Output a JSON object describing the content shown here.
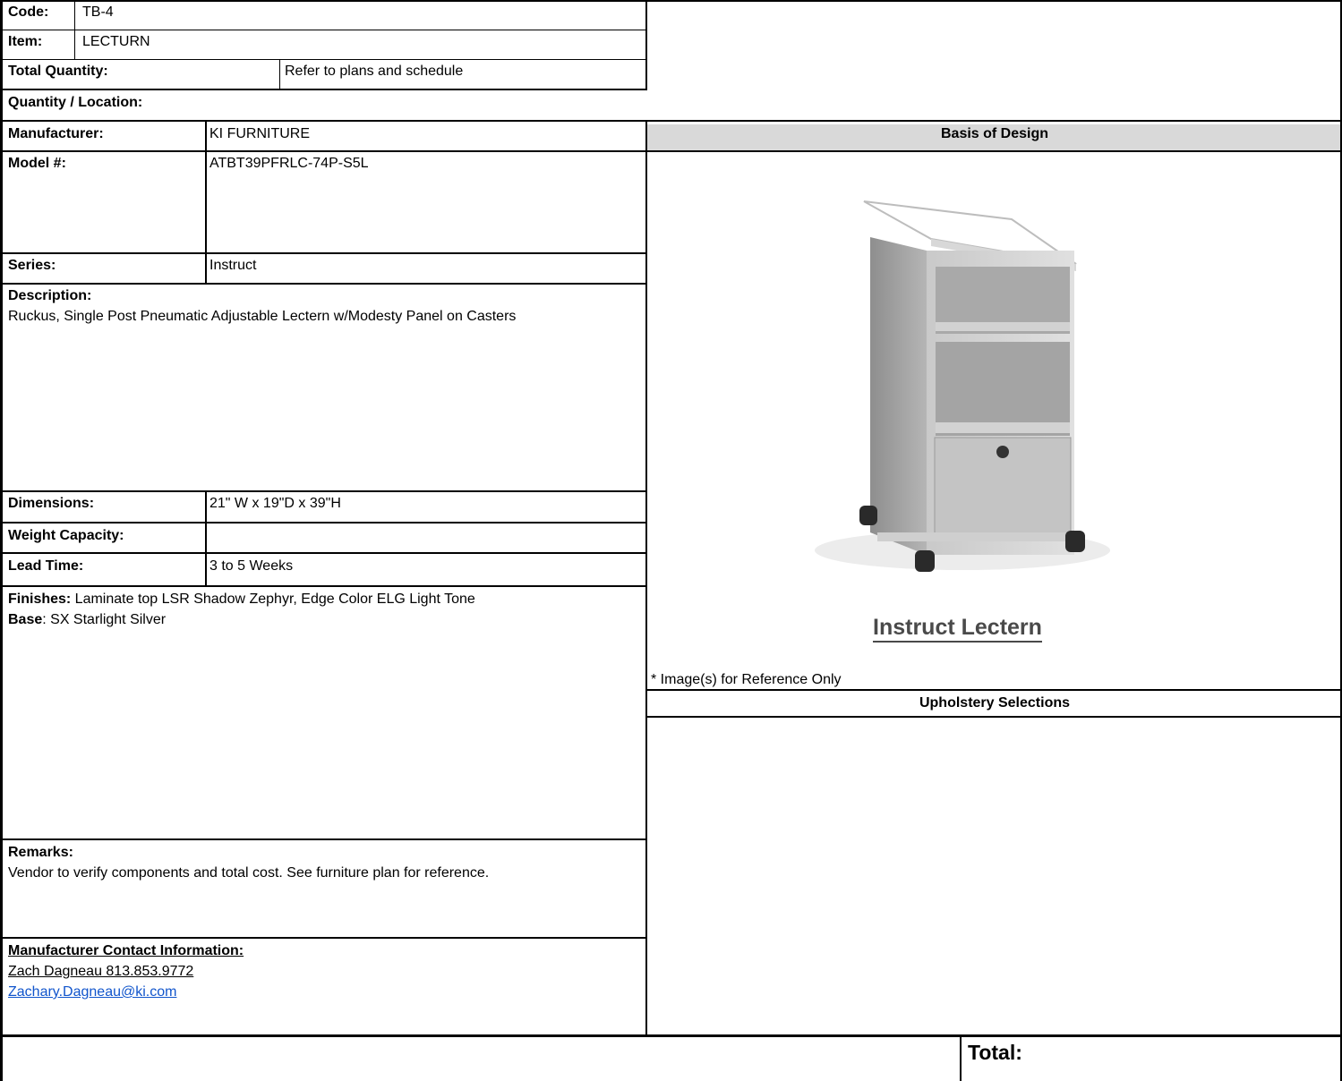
{
  "header": {
    "code_label": "Code:",
    "code_value": "TB-4",
    "item_label": "Item:",
    "item_value": "LECTURN",
    "total_qty_label": "Total Quantity:",
    "total_qty_value": "Refer to plans and schedule",
    "qty_location_label": "Quantity / Location:"
  },
  "specs": {
    "manufacturer_label": "Manufacturer:",
    "manufacturer_value": "KI FURNITURE",
    "model_label": "Model #:",
    "model_value": "ATBT39PFRLC-74P-S5L",
    "series_label": "Series:",
    "series_value": "Instruct",
    "description_label": "Description:",
    "description_value": "Ruckus, Single Post Pneumatic Adjustable Lectern w/Modesty Panel on Casters",
    "dimensions_label": "Dimensions:",
    "dimensions_value": "21\" W x 19\"D x 39\"H",
    "weight_label": "Weight Capacity:",
    "weight_value": "",
    "lead_time_label": "Lead Time:",
    "lead_time_value": "3 to 5 Weeks",
    "finishes_label": "Finishes:",
    "finishes_value": " Laminate top LSR Shadow Zephyr, Edge Color ELG Light Tone",
    "base_label": "Base",
    "base_value": ": SX Starlight Silver",
    "remarks_label": "Remarks:",
    "remarks_value": "Vendor to verify components and total cost. See furniture plan for reference.",
    "contact_label": "Manufacturer Contact Information:",
    "contact_name": "Zach Dagneau 813.853.9772",
    "contact_email": "Zachary.Dagneau@ki.com"
  },
  "right": {
    "basis_header": "Basis of Design",
    "image_caption": "Instruct Lectern",
    "reference_note": "* Image(s) for Reference Only",
    "upholstery_header": "Upholstery Selections"
  },
  "footer": {
    "total_label": "Total:"
  },
  "colors": {
    "header_fill": "#d9d9d9",
    "link": "#1155cc"
  }
}
